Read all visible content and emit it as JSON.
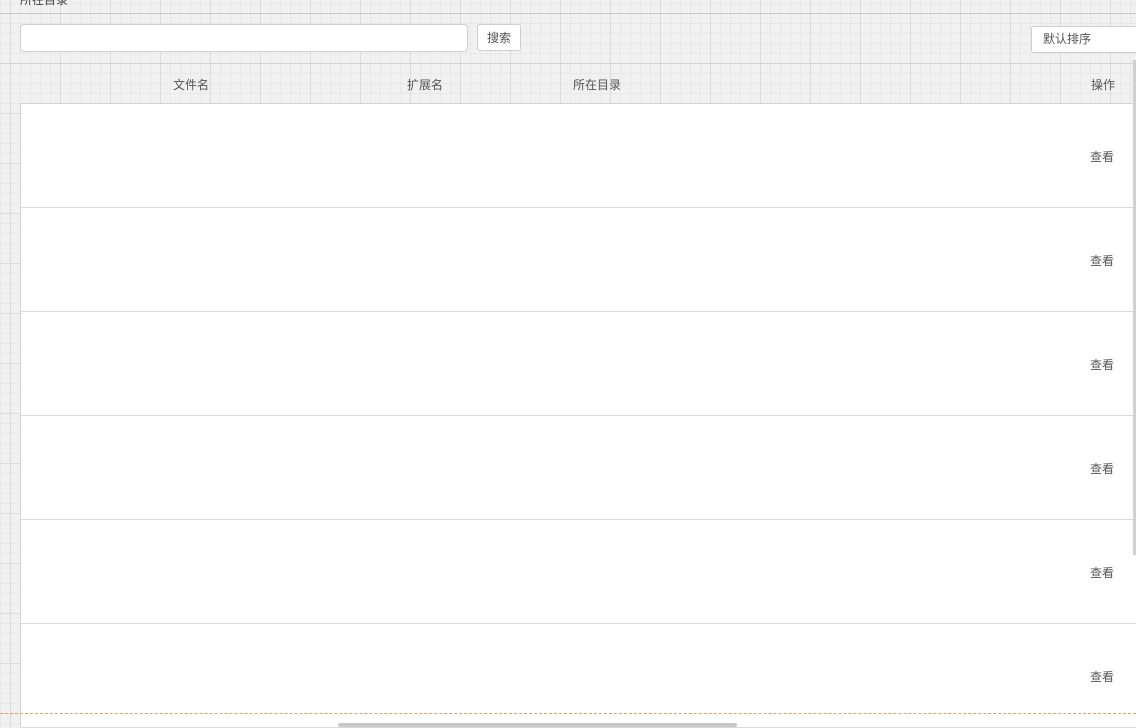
{
  "page": {
    "title_fragment": "所在目录"
  },
  "toolbar": {
    "search_value": "",
    "search_placeholder": "",
    "search_label": "搜索",
    "sort_selected": "默认排序"
  },
  "table": {
    "columns": {
      "filename": "文件名",
      "extension": "扩展名",
      "directory": "所在目录",
      "actions": "操作"
    },
    "rows": [
      {
        "filename": "",
        "extension": "",
        "directory": "",
        "action": "查看"
      },
      {
        "filename": "",
        "extension": "",
        "directory": "",
        "action": "查看"
      },
      {
        "filename": "",
        "extension": "",
        "directory": "",
        "action": "查看"
      },
      {
        "filename": "",
        "extension": "",
        "directory": "",
        "action": "查看"
      },
      {
        "filename": "",
        "extension": "",
        "directory": "",
        "action": "查看"
      },
      {
        "filename": "",
        "extension": "",
        "directory": "",
        "action": "查看"
      }
    ]
  }
}
